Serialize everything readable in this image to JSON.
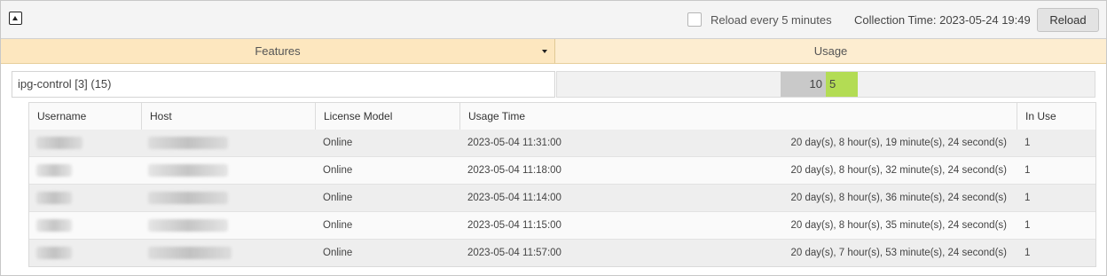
{
  "toolbar": {
    "reload_every_label": "Reload every 5 minutes",
    "collection_time_label": "Collection Time: 2023-05-24 19:49",
    "reload_button_label": "Reload"
  },
  "columns": {
    "features": "Features",
    "usage": "Usage"
  },
  "feature": {
    "name": "ipg-control [3] (15)",
    "total": "10",
    "in_use": "5"
  },
  "subtable": {
    "headers": [
      "Username",
      "Host",
      "License Model",
      "Usage Time",
      "In Use"
    ],
    "rows": [
      {
        "license_model": "Online",
        "usage_time": "2023-05-04 11:31:00",
        "duration": "20 day(s), 8 hour(s), 19 minute(s), 24 second(s)",
        "in_use": "1"
      },
      {
        "license_model": "Online",
        "usage_time": "2023-05-04 11:18:00",
        "duration": "20 day(s), 8 hour(s), 32 minute(s), 24 second(s)",
        "in_use": "1"
      },
      {
        "license_model": "Online",
        "usage_time": "2023-05-04 11:14:00",
        "duration": "20 day(s), 8 hour(s), 36 minute(s), 24 second(s)",
        "in_use": "1"
      },
      {
        "license_model": "Online",
        "usage_time": "2023-05-04 11:15:00",
        "duration": "20 day(s), 8 hour(s), 35 minute(s), 24 second(s)",
        "in_use": "1"
      },
      {
        "license_model": "Online",
        "usage_time": "2023-05-04 11:57:00",
        "duration": "20 day(s), 7 hour(s), 53 minute(s), 24 second(s)",
        "in_use": "1"
      }
    ]
  },
  "icons": {
    "collapse": "collapse-up-icon",
    "sort_caret": "chevron-down-icon"
  },
  "colors": {
    "header_bg": "#fde7bf",
    "usage_total": "#c9c9c9",
    "usage_in_use": "#b3dc54",
    "reload_button": "#e3e3e3"
  }
}
